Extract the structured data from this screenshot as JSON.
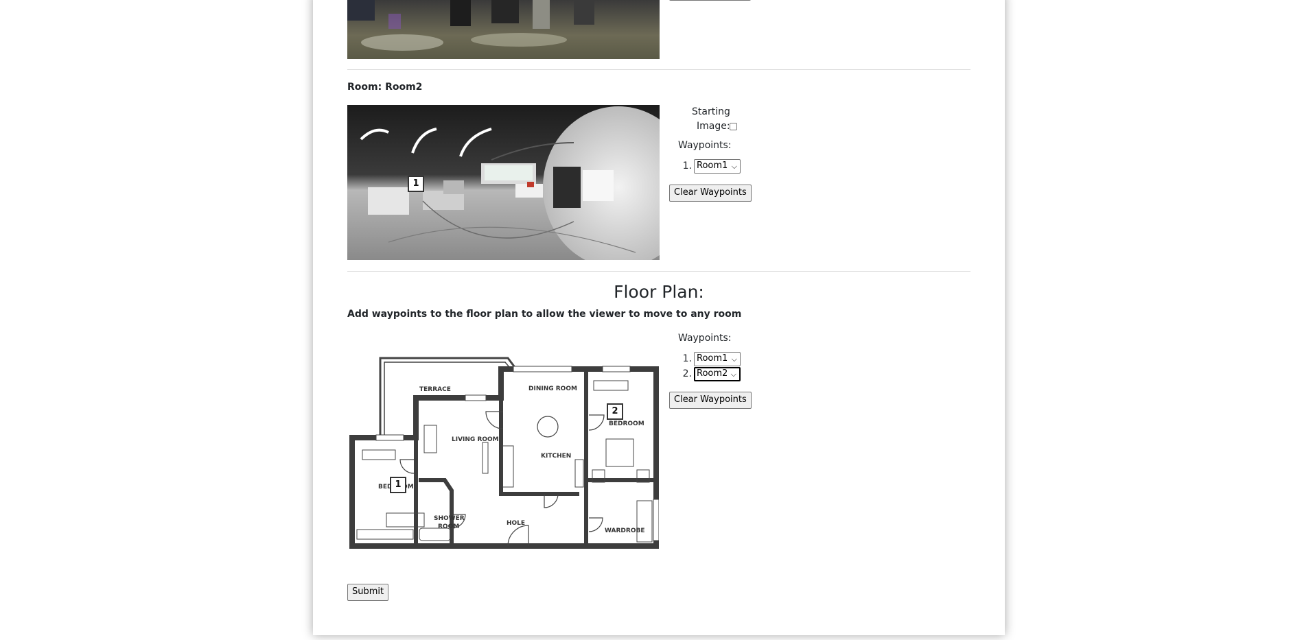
{
  "room2": {
    "title": "Room: Room2",
    "starting_image_label_line1": "Starting",
    "starting_image_label_line2": "Image:",
    "starting_image_checked": false,
    "waypoints_label": "Waypoints:",
    "waypoints": [
      {
        "index": "1.",
        "selected": "Room1"
      }
    ],
    "clear_label": "Clear Waypoints",
    "pano_markers": [
      "1"
    ]
  },
  "floor_plan": {
    "heading": "Floor Plan:",
    "instructions": "Add waypoints to the floor plan to allow the viewer to move to any room",
    "waypoints_label": "Waypoints:",
    "waypoints": [
      {
        "index": "1.",
        "selected": "Room1"
      },
      {
        "index": "2.",
        "selected": "Room2"
      }
    ],
    "clear_label": "Clear Waypoints",
    "markers": [
      "1",
      "2"
    ],
    "room_labels": [
      "TERRACE",
      "DINING ROOM",
      "BEDROOM",
      "LIVING ROOM",
      "KITCHEN",
      "BEDROOM",
      "SHOWER",
      "ROOM",
      "HOLE",
      "WARDROBE"
    ]
  },
  "submit_label": "Submit",
  "icons": {
    "select_arrow": "chevron-down-icon"
  }
}
